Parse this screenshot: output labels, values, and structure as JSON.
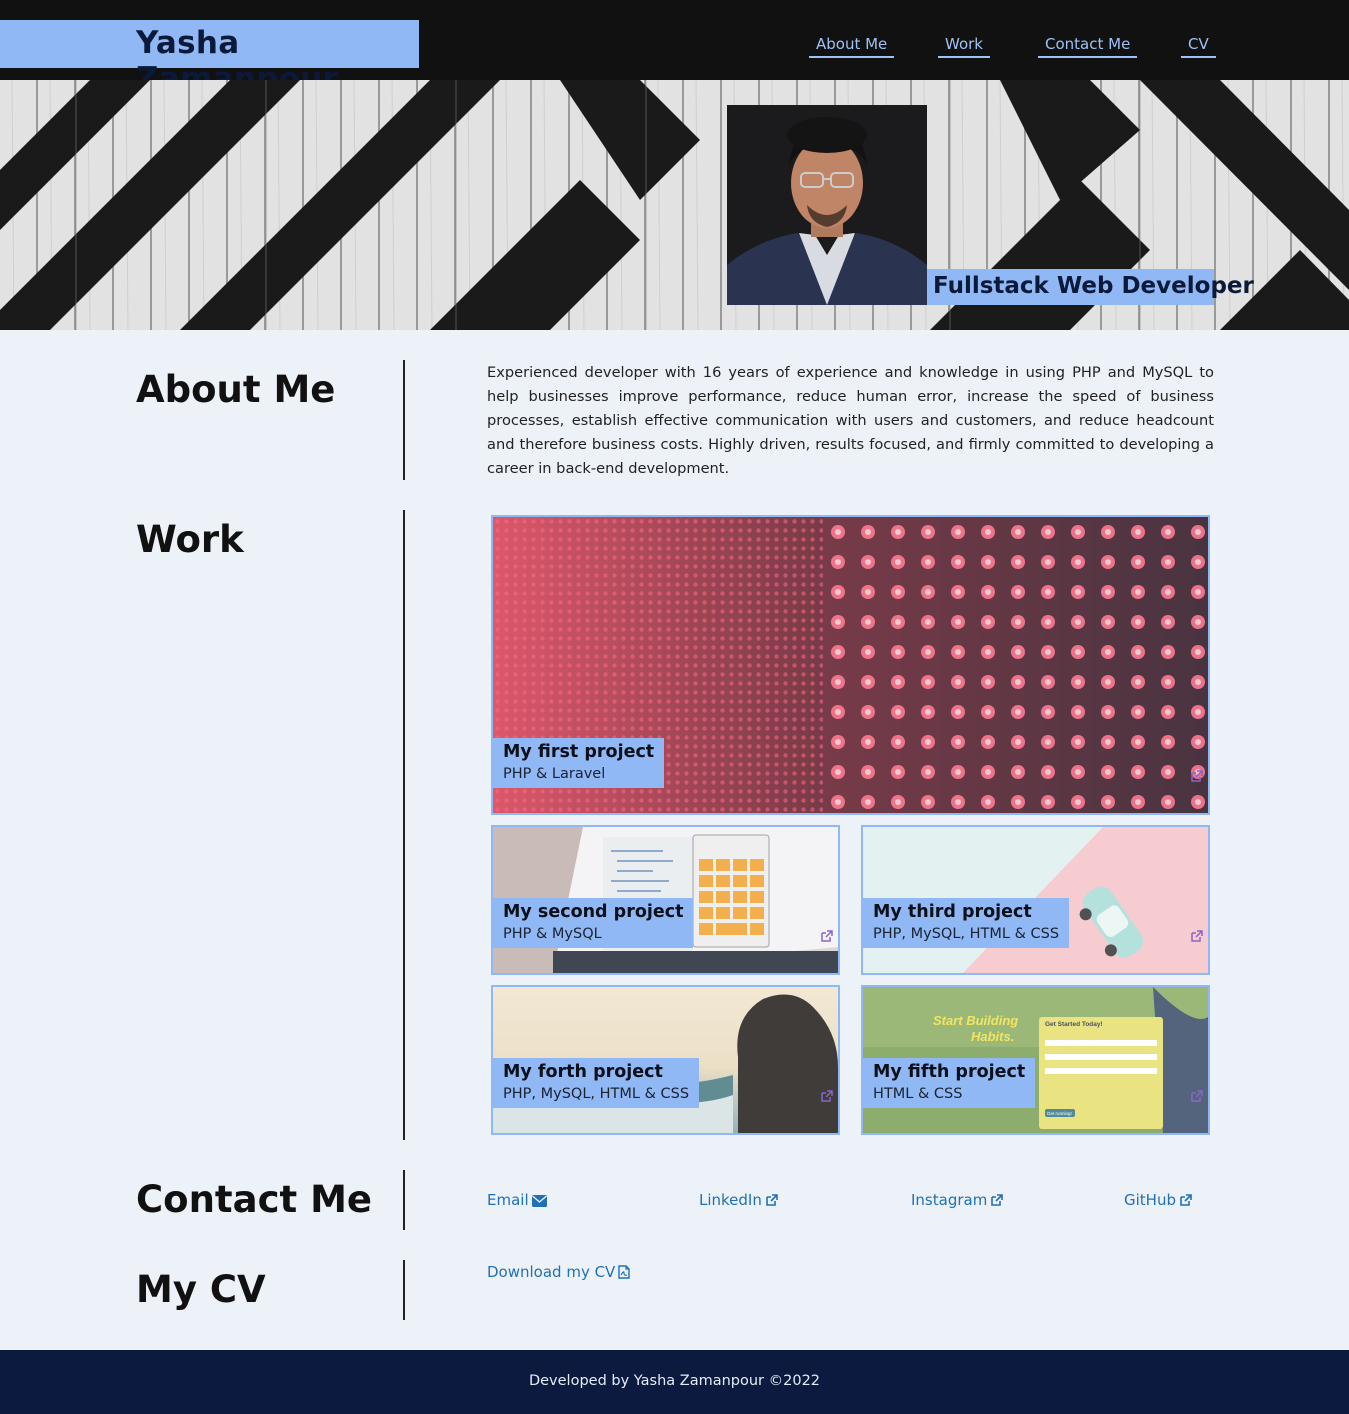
{
  "header": {
    "brand": "Yasha Zamanpour",
    "nav": [
      "About Me",
      "Work",
      "Contact Me",
      "CV"
    ]
  },
  "hero": {
    "role": "Fullstack Web Developer"
  },
  "about": {
    "title": "About Me",
    "text": "Experienced developer with 16 years of experience and knowledge in using PHP and MySQL to help businesses improve performance, reduce human error, increase the speed of business processes, establish effective communication with users and customers, and reduce headcount and therefore business costs. Highly driven, results focused, and firmly committed to developing a career in back-end development."
  },
  "work": {
    "title": "Work",
    "projects": [
      {
        "title": "My first project",
        "stack": "PHP & Laravel"
      },
      {
        "title": "My second project",
        "stack": "PHP & MySQL"
      },
      {
        "title": "My third project",
        "stack": "PHP, MySQL, HTML & CSS"
      },
      {
        "title": "My forth project",
        "stack": "PHP, MySQL, HTML & CSS"
      },
      {
        "title": "My fifth project",
        "stack": "HTML & CSS"
      }
    ],
    "fifth_thumb": {
      "headline1": "Start Building",
      "headline2": "Habits.",
      "form_title": "Get Started Today!",
      "form_button": "Get running!"
    }
  },
  "contact": {
    "title": "Contact Me",
    "links": [
      "Email",
      "LinkedIn",
      "Instagram",
      "GitHub"
    ]
  },
  "cv": {
    "title": "My CV",
    "download": "Download my CV"
  },
  "footer": {
    "text": "Developed by Yasha Zamanpour ©2022"
  },
  "icons": {
    "email": "envelope-icon",
    "external": "external-link-icon",
    "pdf": "file-pdf-icon"
  },
  "colors": {
    "accent": "#90b8f5",
    "header_bg": "#111111",
    "page_bg": "#edf2f8",
    "footer_bg": "#0b1a3e",
    "link": "#2070b8"
  }
}
